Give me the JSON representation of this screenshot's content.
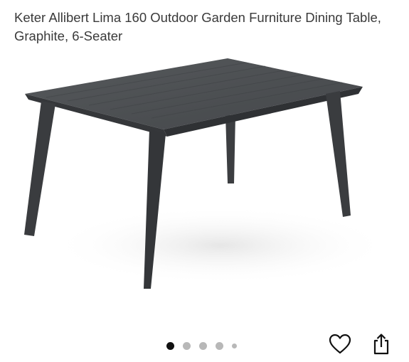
{
  "product": {
    "title": "Keter Allibert Lima 160 Outdoor Garden Furniture Dining Table, Graphite, 6-Seater",
    "image": {
      "subject": "graphite-dining-table",
      "color": "#4a4c4f"
    }
  },
  "carousel": {
    "total_images": 5,
    "active_index": 0
  },
  "actions": {
    "favorite_icon": "heart-outline-icon",
    "share_icon": "share-upload-icon"
  },
  "colors": {
    "table": "#4a4c4f",
    "active_dot": "#111111",
    "inactive_dot": "#b8b8b8"
  }
}
